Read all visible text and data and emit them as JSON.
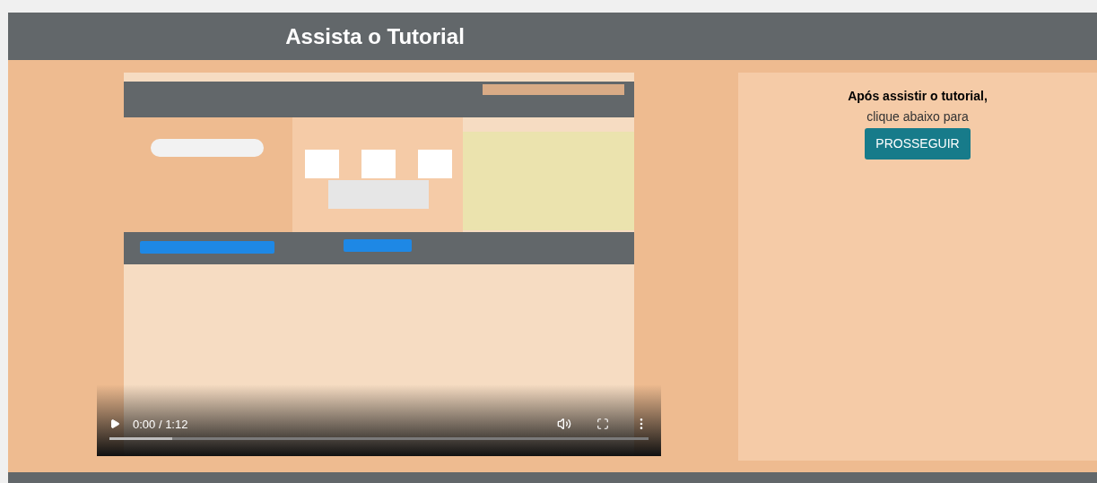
{
  "header": {
    "title": "Assista o Tutorial"
  },
  "video": {
    "kind": "picture",
    "time": "0:00 / 1:12"
  },
  "panel": {
    "heading": "Após assistir o tutorial,",
    "text": "clique abaixo para",
    "button": "PROSSEGUIR"
  }
}
